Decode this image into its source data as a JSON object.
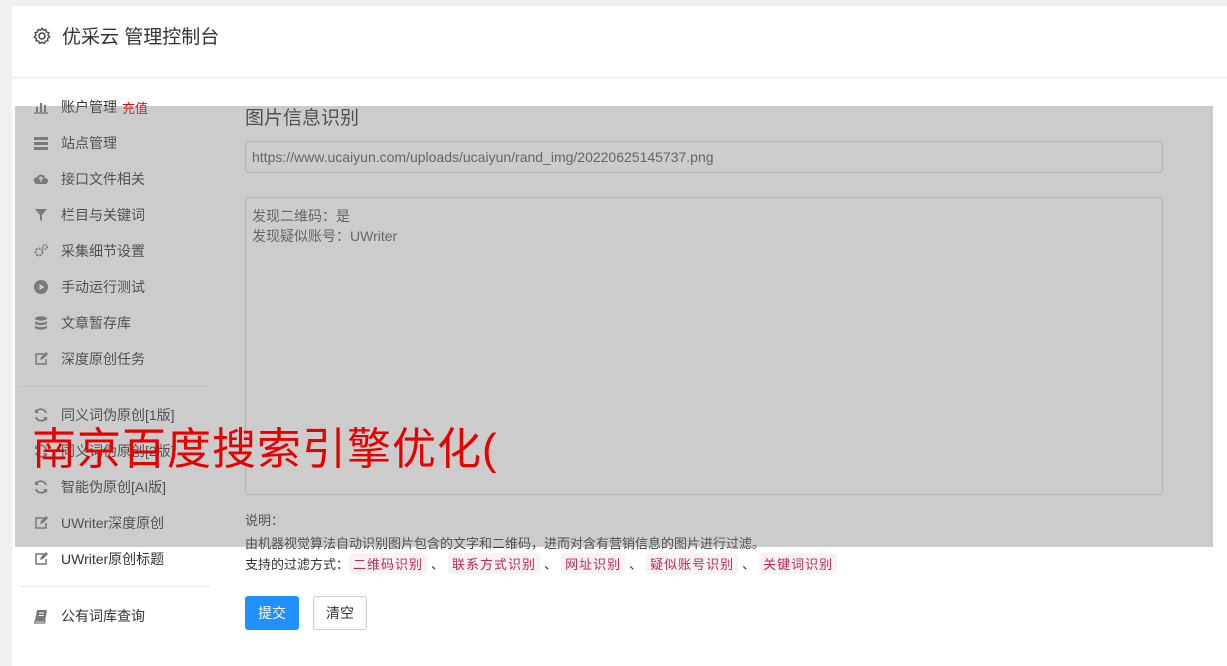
{
  "header": {
    "title": "优采云 管理控制台",
    "icon": "gear-icon"
  },
  "sidebar": {
    "items": [
      {
        "label": "账户管理",
        "badge": "充值",
        "icon": "bar-chart-icon"
      },
      {
        "label": "站点管理",
        "icon": "server-icon"
      },
      {
        "label": "接口文件相关",
        "icon": "cloud-upload-icon"
      },
      {
        "label": "栏目与关键词",
        "icon": "filter-icon"
      },
      {
        "label": "采集细节设置",
        "icon": "gears-icon"
      },
      {
        "label": "手动运行测试",
        "icon": "play-circle-icon"
      },
      {
        "label": "文章暂存库",
        "icon": "database-icon"
      },
      {
        "label": "深度原创任务",
        "icon": "edit-icon"
      },
      {
        "label": "同义词伪原创[1版]",
        "icon": "refresh-icon"
      },
      {
        "label": "同义词伪原创[2版]",
        "icon": "refresh-icon"
      },
      {
        "label": "智能伪原创[AI版]",
        "icon": "refresh-icon"
      },
      {
        "label": "UWriter深度原创",
        "icon": "edit-icon"
      },
      {
        "label": "UWriter原创标题",
        "icon": "edit-icon"
      },
      {
        "label": "公有词库查询",
        "icon": "book-icon"
      }
    ]
  },
  "main": {
    "title": "图片信息识别",
    "url_value": "https://www.ucaiyun.com/uploads/ucaiyun/rand_img/20220625145737.png",
    "result_lines": [
      "发现二维码：是",
      "发现疑似账号：UWriter"
    ],
    "note_label": "说明：",
    "note_text": "由机器视觉算法自动识别图片包含的文字和二维码，进而对含有营销信息的图片进行过滤。",
    "filter_label": "支持的过滤方式：",
    "filter_tags": [
      "二维码识别",
      "联系方式识别",
      "网址识别",
      "疑似账号识别",
      "关键词识别"
    ],
    "tag_separator": "、",
    "submit_label": "提交",
    "clear_label": "清空"
  },
  "watermark": "南京百度搜索引擎优化(",
  "colors": {
    "primary": "#1e90ff",
    "badge": "#e00000",
    "tag_text": "#c7254e",
    "watermark": "#e60000"
  }
}
